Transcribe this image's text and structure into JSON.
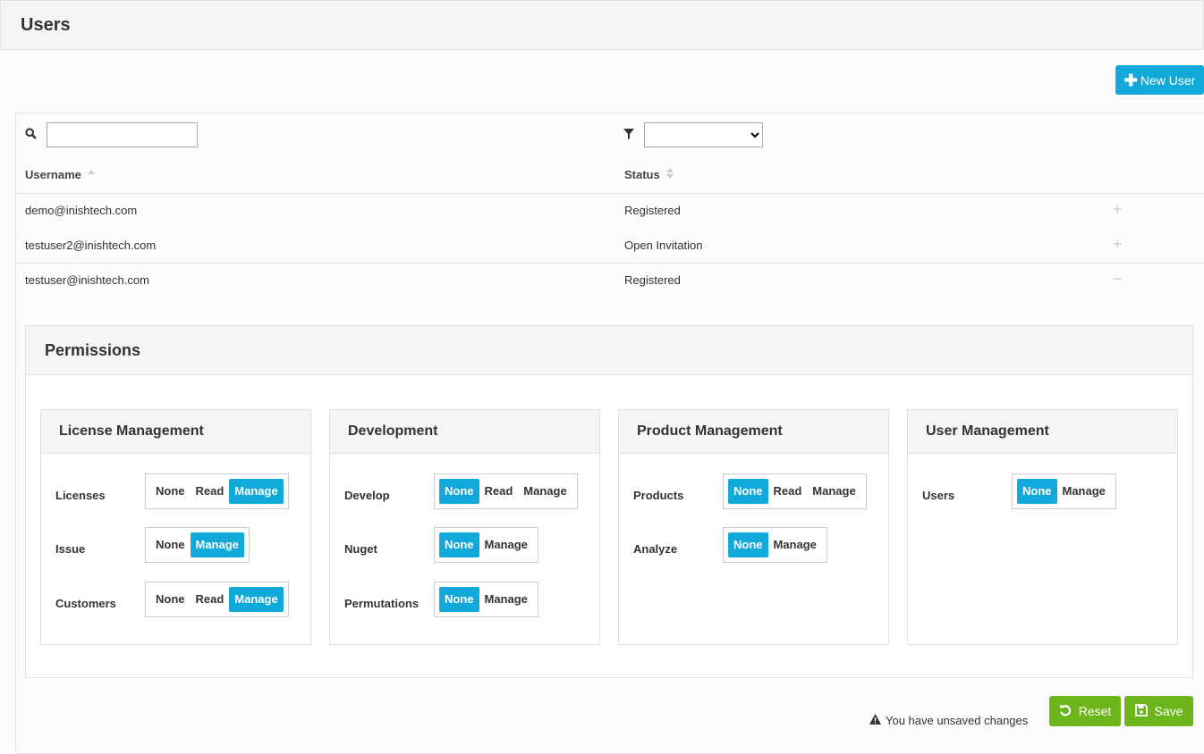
{
  "page": {
    "title": "Users"
  },
  "toolbar": {
    "new_user_label": "New User",
    "new_user_icon": "plus-icon"
  },
  "grid": {
    "search": {
      "value": "",
      "placeholder": ""
    },
    "status_filter": {
      "selected": ""
    },
    "columns": [
      {
        "label": "Username",
        "sort": "ascending"
      },
      {
        "label": "Status",
        "sort": "none"
      }
    ],
    "rows": [
      {
        "username": "demo@inishtech.com",
        "status": "Registered",
        "expanded": false
      },
      {
        "username": "testuser2@inishtech.com",
        "status": "Open Invitation",
        "expanded": false
      },
      {
        "username": "testuser@inishtech.com",
        "status": "Registered",
        "expanded": true
      }
    ]
  },
  "permissions": {
    "title": "Permissions",
    "groups": [
      {
        "title": "License Management",
        "items": [
          {
            "label": "Licenses",
            "options": [
              "None",
              "Read",
              "Manage"
            ],
            "selected": "Manage"
          },
          {
            "label": "Issue",
            "options": [
              "None",
              "Manage"
            ],
            "selected": "Manage"
          },
          {
            "label": "Customers",
            "options": [
              "None",
              "Read",
              "Manage"
            ],
            "selected": "Manage"
          }
        ]
      },
      {
        "title": "Development",
        "items": [
          {
            "label": "Develop",
            "options": [
              "None",
              "Read",
              "Manage"
            ],
            "selected": "None"
          },
          {
            "label": "Nuget",
            "options": [
              "None",
              "Manage"
            ],
            "selected": "None"
          },
          {
            "label": "Permutations",
            "options": [
              "None",
              "Manage"
            ],
            "selected": "None"
          }
        ]
      },
      {
        "title": "Product Management",
        "items": [
          {
            "label": "Products",
            "options": [
              "None",
              "Read",
              "Manage"
            ],
            "selected": "None"
          },
          {
            "label": "Analyze",
            "options": [
              "None",
              "Manage"
            ],
            "selected": "None"
          }
        ]
      },
      {
        "title": "User Management",
        "items": [
          {
            "label": "Users",
            "options": [
              "None",
              "Manage"
            ],
            "selected": "None"
          }
        ]
      }
    ]
  },
  "footer": {
    "warning_text": "You have unsaved changes",
    "reset_label": "Reset",
    "save_label": "Save"
  },
  "colors": {
    "accent": "#11a9da",
    "success": "#6cb51a"
  }
}
